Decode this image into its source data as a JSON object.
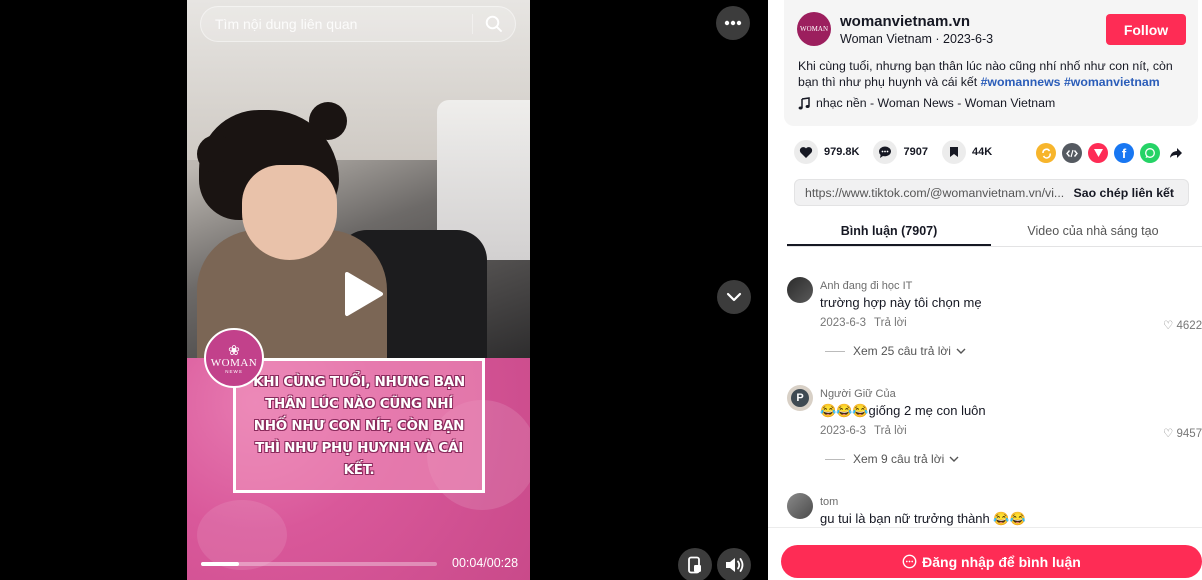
{
  "search": {
    "placeholder": "Tìm nội dung liên quan",
    "icon": "search-icon"
  },
  "video": {
    "caption": "KHI CÙNG  TUỔI, NHƯNG BẠN THÂN LÚC NÀO CŨNG NHÍ NHỐ NHƯ CON NÍT, CÒN BẠN THÌ NHƯ PHỤ HUYNH VÀ CÁI KẾT.",
    "logo_word": "WOMAN",
    "logo_sub": "NEWS",
    "time": "00:04/00:28",
    "progress": 0.16,
    "controls": [
      "more-icon",
      "chevron-down-icon",
      "pip-icon",
      "volume-icon",
      "play-icon"
    ]
  },
  "account": {
    "avatar_text": "WOMAN",
    "name": "womanvietnam.vn",
    "subtitle": "Woman Vietnam · 2023-6-3",
    "follow_label": "Follow",
    "description": "Khi cùng tuổi, nhưng bạn thân lúc nào cũng nhí nhố như con nít, còn bạn thì như phụ huynh và cái kết ",
    "tags": [
      "#womannews",
      "#womanvietnam"
    ],
    "music": "nhạc nền - Woman News - Woman Vietnam"
  },
  "stats": {
    "likes": "979.8K",
    "comments": "7907",
    "saves": "44K"
  },
  "share": {
    "icons": [
      "repost-icon",
      "embed-icon",
      "telegram-icon",
      "facebook-icon",
      "whatsapp-icon",
      "share-arrow-icon"
    ],
    "colors": [
      "#f7b52c",
      "#555a61",
      "#fe2c55",
      "#1877f2",
      "#25d366",
      "#161823"
    ]
  },
  "link": {
    "url": "https://www.tiktok.com/@womanvietnam.vn/vi...",
    "copy_label": "Sao chép liên kết"
  },
  "tabs": [
    {
      "label": "Bình luận (7907)"
    },
    {
      "label": "Video của nhà sáng tạo"
    }
  ],
  "comments": [
    {
      "user": "Anh đang đi học IT",
      "text": "trường hợp này tôi chọn mẹ",
      "date": "2023-6-3",
      "reply": "Trả lời",
      "likes": "4622",
      "more": "Xem 25 câu trả lời"
    },
    {
      "user": "Người Giữ Của",
      "text": "😂😂😂giống 2 mẹ con luôn",
      "date": "2023-6-3",
      "reply": "Trả lời",
      "likes": "9457",
      "more": "Xem 9 câu trả lời",
      "avatar_letter": "P"
    },
    {
      "user": "tom",
      "text": "gu tui là bạn nữ trưởng thành 😂😂"
    }
  ],
  "login": {
    "label": "Đăng nhập để bình luận"
  },
  "colors": {
    "accent": "#fe2c55",
    "hashtag": "#2b5db9"
  }
}
